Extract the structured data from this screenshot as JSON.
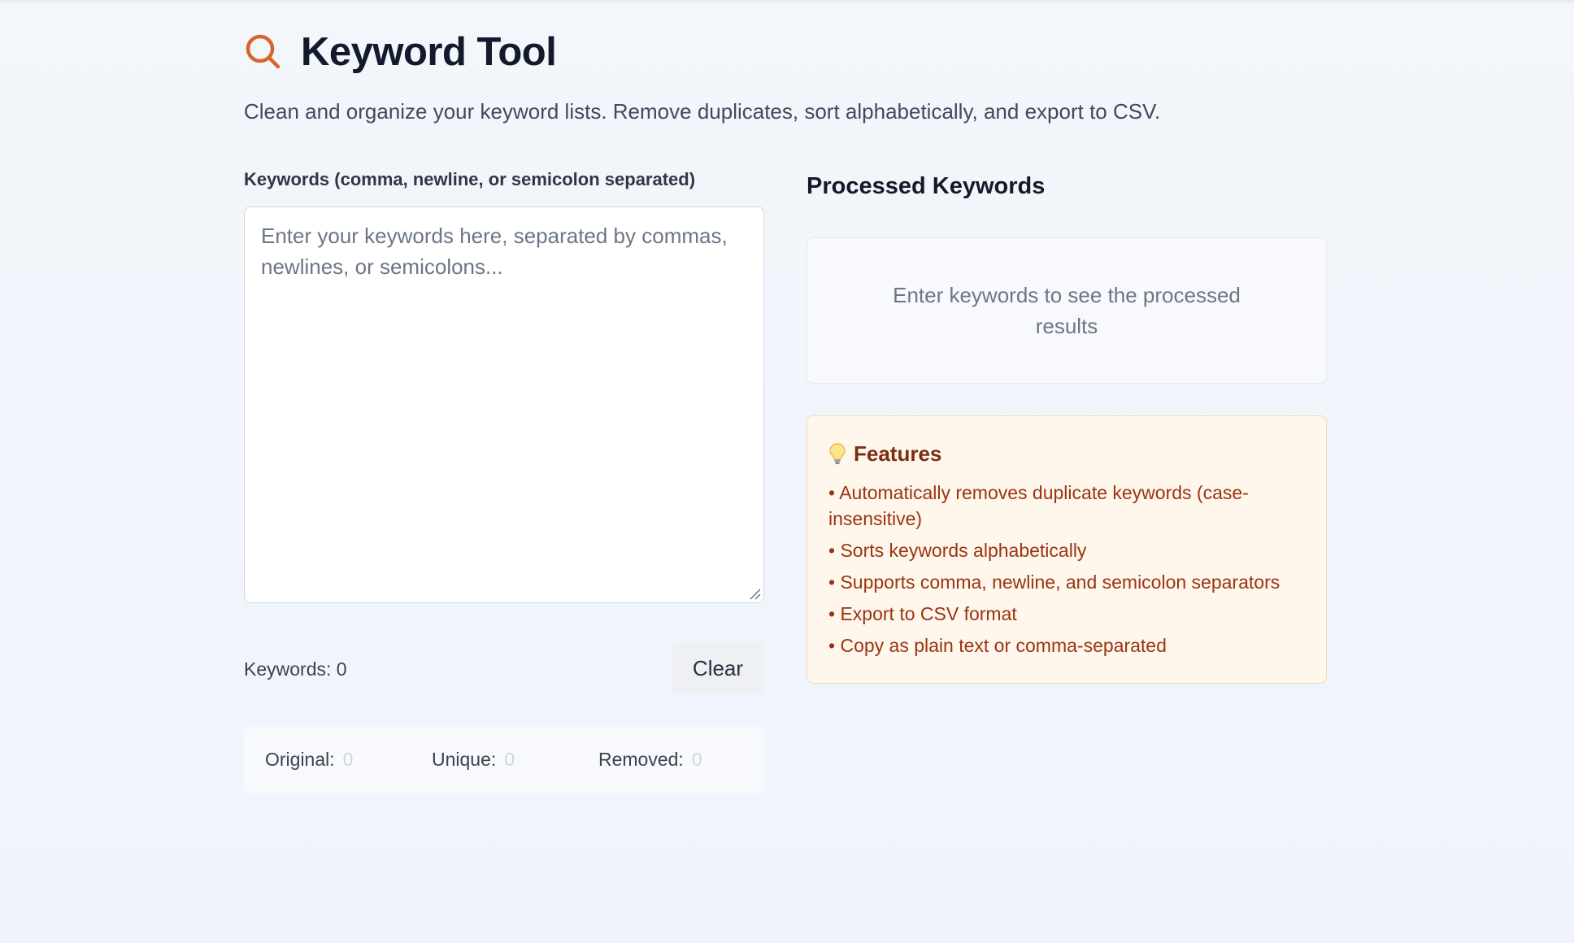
{
  "header": {
    "title": "Keyword Tool",
    "subtitle": "Clean and organize your keyword lists. Remove duplicates, sort alphabetically, and export to CSV.",
    "icon": "search-icon",
    "accent_color": "#d9652e"
  },
  "input": {
    "label": "Keywords (comma, newline, or semicolon separated)",
    "value": "",
    "placeholder": "Enter your keywords here, separated by commas, newlines, or semicolons..."
  },
  "counter": {
    "label": "Keywords:",
    "value": "0"
  },
  "actions": {
    "clear_label": "Clear"
  },
  "stats": {
    "original_label": "Original:",
    "original_value": "0",
    "unique_label": "Unique:",
    "unique_value": "0",
    "removed_label": "Removed:",
    "removed_value": "0"
  },
  "results": {
    "title": "Processed Keywords",
    "empty_message": "Enter keywords to see the processed results"
  },
  "features": {
    "icon": "lightbulb-icon",
    "title": "Features",
    "items": [
      "Automatically removes duplicate keywords (case-insensitive)",
      "Sorts keywords alphabetically",
      "Supports comma, newline, and semicolon separators",
      "Export to CSV format",
      "Copy as plain text or comma-separated"
    ]
  }
}
